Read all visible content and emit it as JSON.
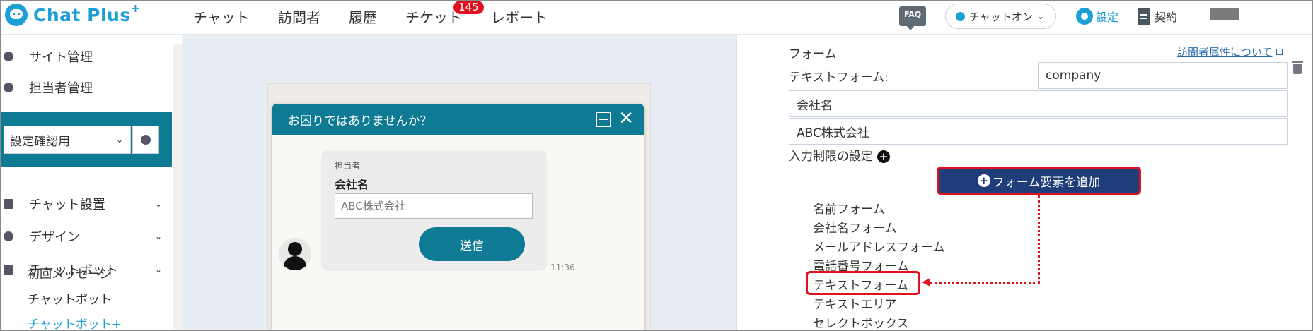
{
  "header": {
    "logo_text": "Chat Plus",
    "logo_plus": "+",
    "nav": [
      "チャット",
      "訪問者",
      "履歴",
      "チケット",
      "レポート"
    ],
    "ticket_badge": "145",
    "faq": "FAQ",
    "chat_status": "チャットオン",
    "settings": "設定",
    "contract": "契約"
  },
  "sidebar": {
    "site_admin": "サイト管理",
    "staff_admin": "担当者管理",
    "site_select": "設定確認用",
    "chat_settings": "チャット設置",
    "design": "デザイン",
    "chatbot": "チャットボット",
    "sub_first_message": "初回メッセージ",
    "sub_chatbot": "チャットボット",
    "sub_chatbot_plus": "チャットボット+"
  },
  "widget": {
    "title": "お困りではありませんか？",
    "staff_label": "担当者",
    "field_label": "会社名",
    "input_placeholder": "ABC株式会社",
    "send_label": "送信",
    "time": "11:36"
  },
  "panel": {
    "form_label": "フォーム",
    "attr_link": "訪問者属性について",
    "text_form_label": "テキストフォーム:",
    "key_value": "company",
    "label_value": "会社名",
    "placeholder_value": "ABC株式会社",
    "input_limit": "入力制限の設定",
    "add_element": "フォーム要素を追加",
    "options": [
      "名前フォーム",
      "会社名フォーム",
      "メールアドレスフォーム",
      "電話番号フォーム",
      "テキストフォーム",
      "テキストエリア",
      "セレクトボックス"
    ]
  },
  "colors": {
    "brand_blue": "#1c9fd4",
    "teal": "#0e7a94",
    "navy_button": "#1e3d7a",
    "highlight_red": "#e0101e"
  }
}
